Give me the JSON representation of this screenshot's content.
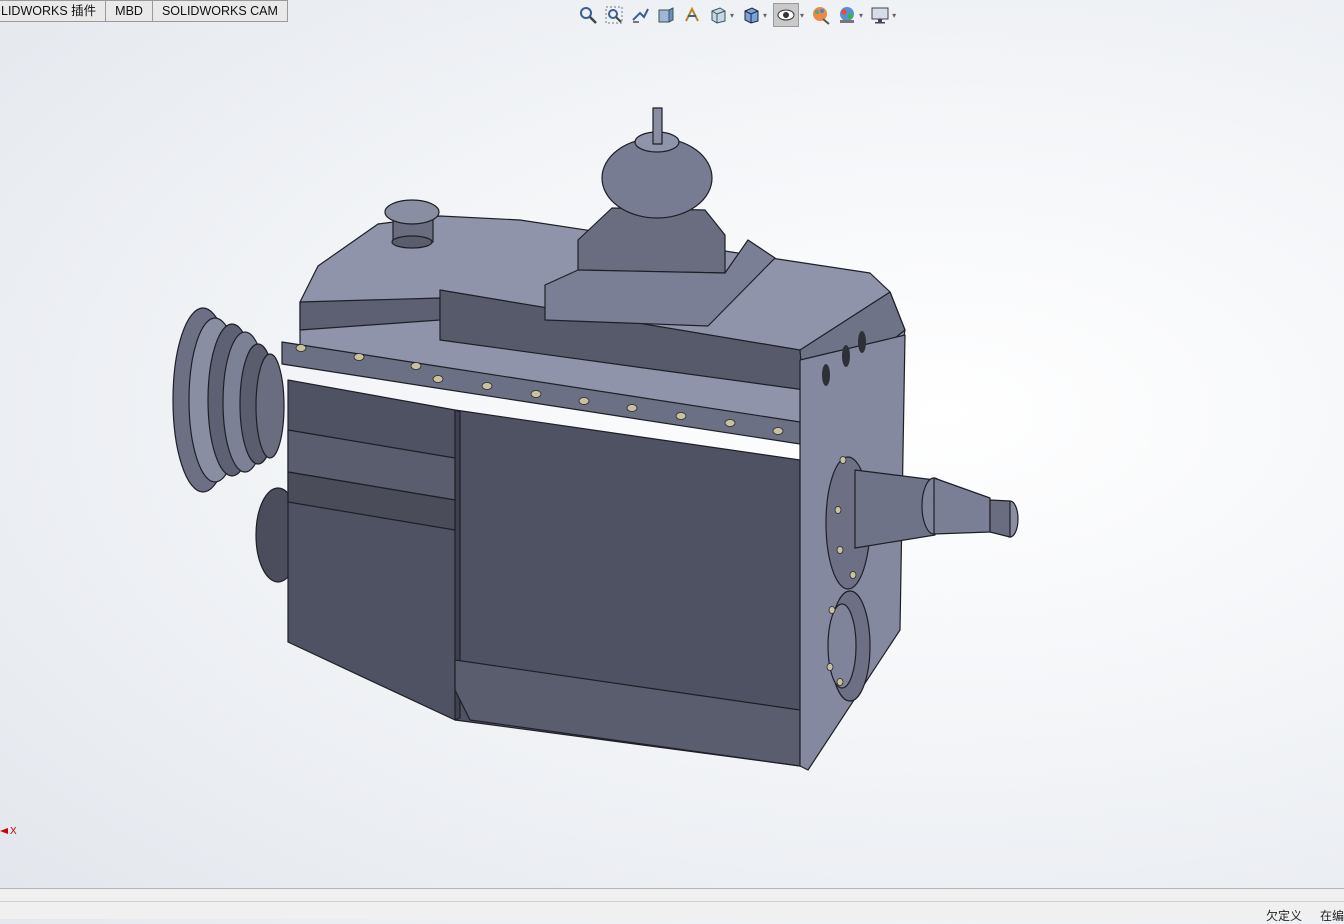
{
  "command_tabs": [
    {
      "label": "LIDWORKS 插件"
    },
    {
      "label": "MBD"
    },
    {
      "label": "SOLIDWORKS CAM"
    }
  ],
  "view_toolbar": {
    "buttons": [
      {
        "icon": "zoom-to-fit-icon"
      },
      {
        "icon": "zoom-to-area-icon"
      },
      {
        "icon": "previous-view-icon"
      },
      {
        "icon": "section-view-icon"
      },
      {
        "icon": "dynamic-annotation-views-icon"
      },
      {
        "icon": "view-orientation-icon"
      },
      {
        "icon": "display-style-icon"
      },
      {
        "icon": "hide-show-items-icon"
      },
      {
        "icon": "edit-appearance-icon"
      },
      {
        "icon": "apply-scene-icon"
      },
      {
        "icon": "view-settings-icon"
      }
    ]
  },
  "model": {
    "name": "gearbox-assembly"
  },
  "triad": {
    "axis_label": "X"
  },
  "status_bar": {
    "left_text": "欠定义",
    "right_text": "在编"
  },
  "colors": {
    "body": "#5a5d6e",
    "body_light": "#8f94aa",
    "body_dark": "#3f4150",
    "accent": "#c8c1a2"
  }
}
